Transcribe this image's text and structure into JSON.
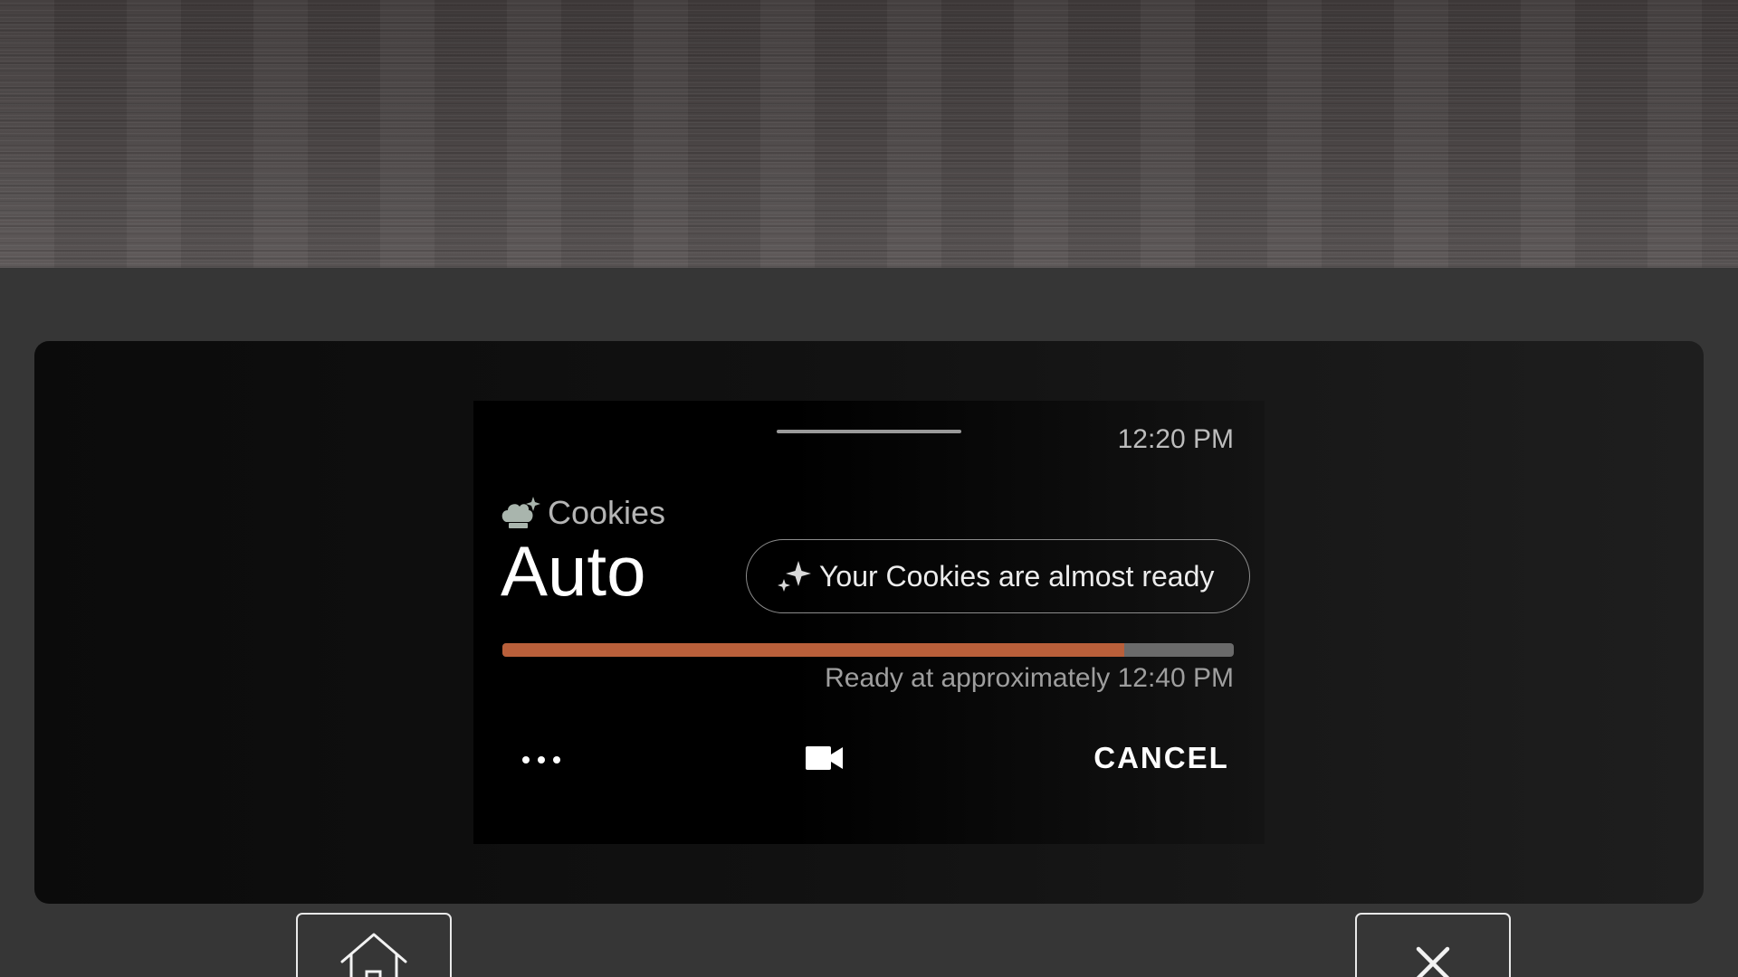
{
  "screen": {
    "time": "12:20 PM",
    "recipe": {
      "icon": "chef-hat-sparkle-icon",
      "name": "Cookies"
    },
    "mode": "Auto",
    "status_message": {
      "icon": "sparkle-icon",
      "text": "Your Cookies are almost ready"
    },
    "progress": {
      "fraction": 0.85,
      "fill_color": "#b95f3a",
      "track_color": "#6a6a6a"
    },
    "ready_text": "Ready at approximately 12:40 PM",
    "actions": {
      "more_icon": "more-horizontal-icon",
      "camera_icon": "video-camera-icon",
      "cancel_label": "CANCEL"
    }
  },
  "side_buttons": {
    "left_icon": "home-icon",
    "right_icon": "close-icon"
  }
}
